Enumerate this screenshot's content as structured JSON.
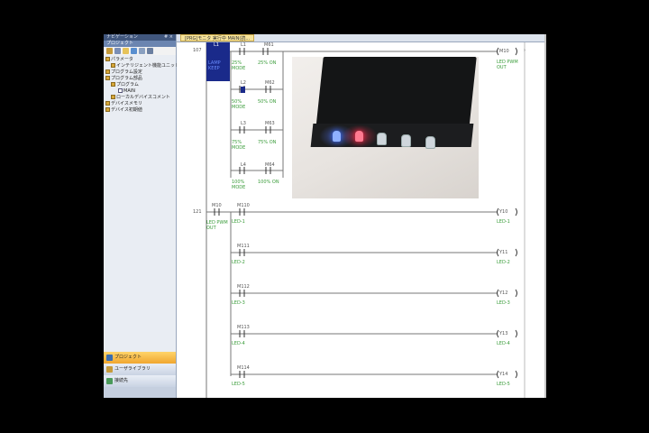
{
  "navigation": {
    "title": "ナビゲーション",
    "pin": "# ×",
    "subtitle": "プロジェクト",
    "tree": [
      {
        "label": "パラメータ"
      },
      {
        "label": "インテリジェント機能ユニット"
      },
      {
        "label": "プログラム設定"
      },
      {
        "label": "プログラム部品"
      },
      {
        "label": "プログラム"
      },
      {
        "label": "MAIN"
      },
      {
        "label": "ローカルデバイスコメント"
      },
      {
        "label": "デバイスメモリ"
      },
      {
        "label": "デバイス初期値"
      }
    ],
    "bottom_buttons": [
      {
        "label": "プロジェクト"
      },
      {
        "label": "ユーザライブラリ"
      },
      {
        "label": "接続先"
      }
    ]
  },
  "tab": {
    "label": "[PRG]モニタ 実行中 MAIN(読..."
  },
  "ladder": {
    "rung1": {
      "step": "107",
      "contacts": [
        {
          "device": "L1",
          "comment": "LAMP KEEP"
        },
        {
          "device": "L1",
          "comment": "25% MODE"
        },
        {
          "device": "M61",
          "comment": "25% ON"
        },
        {
          "device": "L2",
          "comment": "50% MODE"
        },
        {
          "device": "M62",
          "comment": "50% ON"
        },
        {
          "device": "L3",
          "comment": "75% MODE"
        },
        {
          "device": "M63",
          "comment": "75% ON"
        },
        {
          "device": "L4",
          "comment": "100% MODE"
        },
        {
          "device": "M64",
          "comment": "100% ON"
        }
      ],
      "coil": {
        "device": "M10",
        "comment": "LED PWM OUT"
      }
    },
    "rung2": {
      "step": "121",
      "input": {
        "device": "M10",
        "comment": "LED PWM OUT"
      },
      "branches": [
        {
          "device": "M110",
          "comment": "LED-1",
          "coil": "Y10",
          "coil_comment": "LED-1"
        },
        {
          "device": "M111",
          "comment": "LED-2",
          "coil": "Y11",
          "coil_comment": "LED-2"
        },
        {
          "device": "M112",
          "comment": "LED-3",
          "coil": "Y12",
          "coil_comment": "LED-3"
        },
        {
          "device": "M113",
          "comment": "LED-4",
          "coil": "Y13",
          "coil_comment": "LED-4"
        },
        {
          "device": "M114",
          "comment": "LED-5",
          "coil": "Y14",
          "coil_comment": "LED-5"
        }
      ]
    }
  },
  "colors": {
    "comment_green": "#3a9c3a",
    "selection_blue": "#1a2a8a",
    "led_blue": "#3a6cff",
    "led_red": "#ff3050"
  }
}
